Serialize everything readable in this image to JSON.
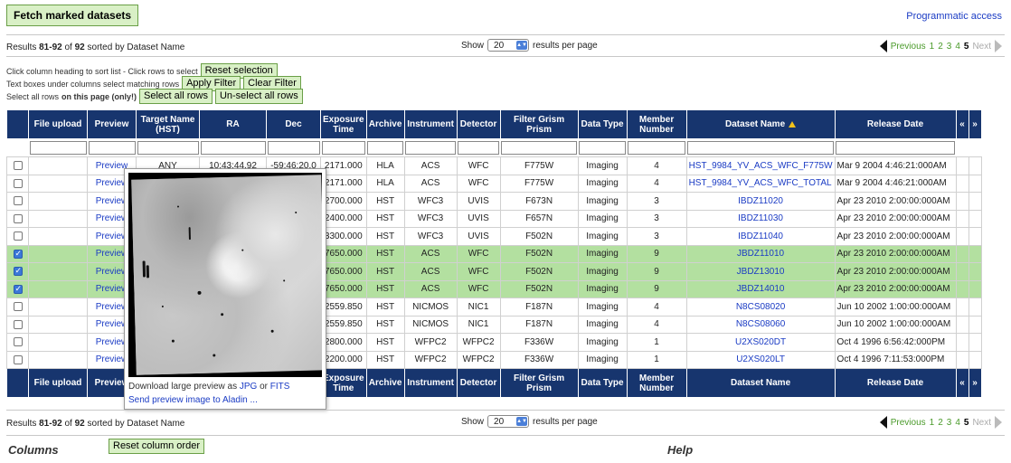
{
  "toolbar": {
    "fetch_label": "Fetch marked datasets",
    "programmatic_label": "Programmatic access"
  },
  "results": {
    "prefix": "Results ",
    "range": "81-92",
    "of": " of ",
    "total": "92",
    "suffix": " sorted by Dataset Name"
  },
  "show": {
    "label": "Show",
    "value": "20",
    "suffix": "results per page"
  },
  "pager": {
    "previous": "Previous",
    "pages": [
      "1",
      "2",
      "3",
      "4",
      "5"
    ],
    "current": "5",
    "next": "Next"
  },
  "help": {
    "line1": "Click column heading to sort list - Click rows to select",
    "reset_selection": "Reset selection",
    "line2": "Text boxes under columns select matching rows",
    "apply_filter": "Apply Filter",
    "clear_filter": "Clear Filter",
    "line3a": "Select all rows ",
    "line3b": "on this page (only!)",
    "select_all": "Select all rows",
    "unselect_all": "Un-select all rows"
  },
  "columns": [
    "File upload",
    "Preview",
    "Target Name (HST)",
    "RA",
    "Dec",
    "Exposure Time",
    "Archive",
    "Instrument",
    "Detector",
    "Filter Grism Prism",
    "Data Type",
    "Member Number",
    "Dataset Name",
    "Release Date"
  ],
  "nav_arrows": {
    "left": "«",
    "right": "»"
  },
  "rows": [
    {
      "checked": false,
      "preview": "Preview",
      "target": "ANY",
      "ra": "10:43:44.92",
      "dec": "-59:46:20.0",
      "exp": "2171.000",
      "archive": "HLA",
      "instrument": "ACS",
      "detector": "WFC",
      "filter": "F775W",
      "dtype": "Imaging",
      "member": "4",
      "dataset": "HST_9984_YV_ACS_WFC_F775W",
      "release": "Mar 9 2004 4:46:21:000AM"
    },
    {
      "checked": false,
      "preview": "Preview",
      "target": "",
      "ra": "",
      "dec": "",
      "exp": "2171.000",
      "archive": "HLA",
      "instrument": "ACS",
      "detector": "WFC",
      "filter": "F775W",
      "dtype": "Imaging",
      "member": "4",
      "dataset": "HST_9984_YV_ACS_WFC_TOTAL",
      "release": "Mar 9 2004 4:46:21:000AM"
    },
    {
      "checked": false,
      "preview": "Preview",
      "target": "",
      "ra": "",
      "dec": "",
      "exp": "2700.000",
      "archive": "HST",
      "instrument": "WFC3",
      "detector": "UVIS",
      "filter": "F673N",
      "dtype": "Imaging",
      "member": "3",
      "dataset": "IBDZ11020",
      "release": "Apr 23 2010 2:00:00:000AM"
    },
    {
      "checked": false,
      "preview": "Preview",
      "target": "",
      "ra": "",
      "dec": "",
      "exp": "2400.000",
      "archive": "HST",
      "instrument": "WFC3",
      "detector": "UVIS",
      "filter": "F657N",
      "dtype": "Imaging",
      "member": "3",
      "dataset": "IBDZ11030",
      "release": "Apr 23 2010 2:00:00:000AM"
    },
    {
      "checked": false,
      "preview": "Preview",
      "target": "",
      "ra": "",
      "dec": "",
      "exp": "3300.000",
      "archive": "HST",
      "instrument": "WFC3",
      "detector": "UVIS",
      "filter": "F502N",
      "dtype": "Imaging",
      "member": "3",
      "dataset": "IBDZ11040",
      "release": "Apr 23 2010 2:00:00:000AM"
    },
    {
      "checked": true,
      "preview": "Preview",
      "target": "",
      "ra": "",
      "dec": "",
      "exp": "7650.000",
      "archive": "HST",
      "instrument": "ACS",
      "detector": "WFC",
      "filter": "F502N",
      "dtype": "Imaging",
      "member": "9",
      "dataset": "JBDZ11010",
      "release": "Apr 23 2010 2:00:00:000AM"
    },
    {
      "checked": true,
      "preview": "Preview",
      "target": "",
      "ra": "",
      "dec": "",
      "exp": "7650.000",
      "archive": "HST",
      "instrument": "ACS",
      "detector": "WFC",
      "filter": "F502N",
      "dtype": "Imaging",
      "member": "9",
      "dataset": "JBDZ13010",
      "release": "Apr 23 2010 2:00:00:000AM"
    },
    {
      "checked": true,
      "preview": "Preview",
      "target": "",
      "ra": "",
      "dec": "",
      "exp": "7650.000",
      "archive": "HST",
      "instrument": "ACS",
      "detector": "WFC",
      "filter": "F502N",
      "dtype": "Imaging",
      "member": "9",
      "dataset": "JBDZ14010",
      "release": "Apr 23 2010 2:00:00:000AM"
    },
    {
      "checked": false,
      "preview": "Preview",
      "target": "",
      "ra": "",
      "dec": "",
      "exp": "2559.850",
      "archive": "HST",
      "instrument": "NICMOS",
      "detector": "NIC1",
      "filter": "F187N",
      "dtype": "Imaging",
      "member": "4",
      "dataset": "N8CS08020",
      "release": "Jun 10 2002 1:00:00:000AM"
    },
    {
      "checked": false,
      "preview": "Preview",
      "target": "",
      "ra": "",
      "dec": "",
      "exp": "2559.850",
      "archive": "HST",
      "instrument": "NICMOS",
      "detector": "NIC1",
      "filter": "F187N",
      "dtype": "Imaging",
      "member": "4",
      "dataset": "N8CS08060",
      "release": "Jun 10 2002 1:00:00:000AM"
    },
    {
      "checked": false,
      "preview": "Preview",
      "target": "",
      "ra": "",
      "dec": "",
      "exp": "2800.000",
      "archive": "HST",
      "instrument": "WFPC2",
      "detector": "WFPC2",
      "filter": "F336W",
      "dtype": "Imaging",
      "member": "1",
      "dataset": "U2XS020DT",
      "release": "Oct 4 1996 6:56:42:000PM"
    },
    {
      "checked": false,
      "preview": "Preview",
      "target": "",
      "ra": "",
      "dec": "",
      "exp": "2200.000",
      "archive": "HST",
      "instrument": "WFPC2",
      "detector": "WFPC2",
      "filter": "F336W",
      "dtype": "Imaging",
      "member": "1",
      "dataset": "U2XS020LT",
      "release": "Oct 4 1996 7:11:53:000PM"
    }
  ],
  "popup": {
    "download_text": "Download large preview as ",
    "jpg": "JPG",
    "or": " or ",
    "fits": "FITS",
    "send_aladin": "Send preview image to Aladin ..."
  },
  "footer": {
    "columns_title": "Columns",
    "reset_order": "Reset column order",
    "help_title": "Help"
  },
  "colors": {
    "header_bg": "#17356e",
    "selected_row": "#b3e0a0",
    "link": "#1a3bc4",
    "button_bg": "#d9f0c6"
  },
  "icons": {
    "sort": "sort-ascending-icon",
    "prev": "arrow-left-icon",
    "next": "arrow-right-icon"
  }
}
